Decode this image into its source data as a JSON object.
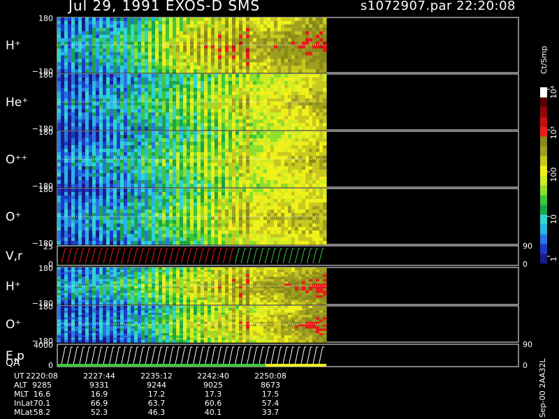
{
  "header": {
    "title_left": "Jul 29, 1991    EXOS-D SMS",
    "title_right": "s1072907.par  22:20:08"
  },
  "colorbar": {
    "unit_label": "Ct/Smp",
    "tick_labels": [
      "1",
      "10",
      "100",
      "10³",
      "10⁴"
    ],
    "colors": [
      "#1a1a8c",
      "#1c3cc8",
      "#2876e0",
      "#2ab4e6",
      "#30d6d0",
      "#1aa64a",
      "#3ec83a",
      "#8ee02c",
      "#d2ec24",
      "#f0f01a",
      "#c8c820",
      "#a0a020",
      "#8a8a1a",
      "#e81c1c",
      "#c01010",
      "#900808",
      "#5a0000",
      "#ffffff"
    ]
  },
  "footer_code": "Sep-00 2AA32L",
  "ephemeris": {
    "labels": [
      "UT",
      "ALT",
      "MLT",
      "InLat",
      "MLat"
    ],
    "columns": [
      [
        "2220:08",
        "9285",
        "16.6",
        "70.1",
        "58.2"
      ],
      [
        "2227:44",
        "9331",
        "16.9",
        "66.9",
        "52.3"
      ],
      [
        "2235:12",
        "9244",
        "17.2",
        "63.7",
        "46.3"
      ],
      [
        "2242:40",
        "9025",
        "17.3",
        "60.6",
        "40.1"
      ],
      [
        "2250:08",
        "8673",
        "17.5",
        "57.4",
        "33.7"
      ]
    ]
  },
  "chart_data": {
    "type": "heatmap",
    "time_axis": {
      "start": "2220:08",
      "end": "2250:08",
      "ticks": [
        "2220:08",
        "2227:44",
        "2235:12",
        "2242:40",
        "2250:08"
      ],
      "data_end": "2250:08"
    },
    "panels": [
      {
        "label": "H⁺",
        "kind": "angle-spectrogram",
        "ytick_top": "180",
        "ytick_bottom": "−180",
        "intensity_profile": [
          2,
          4,
          9,
          11,
          13
        ]
      },
      {
        "label": "He⁺",
        "kind": "angle-spectrogram",
        "ytick_top": "180",
        "ytick_bottom": "−180",
        "intensity_profile": [
          1,
          3,
          6,
          9,
          11
        ]
      },
      {
        "label": "O⁺⁺",
        "kind": "angle-spectrogram",
        "ytick_top": "180",
        "ytick_bottom": "−180",
        "intensity_profile": [
          1,
          3,
          6,
          9,
          11
        ]
      },
      {
        "label": "O⁺",
        "kind": "angle-spectrogram",
        "ytick_top": "180",
        "ytick_bottom": "−180",
        "intensity_profile": [
          1,
          3,
          6,
          10,
          11
        ]
      },
      {
        "label": "V,r",
        "kind": "line",
        "ytick_top": "25",
        "ytick_bottom": "0",
        "right_top": "90",
        "right_bottom": "0"
      },
      {
        "label": "H⁺",
        "kind": "angle-spectrogram",
        "ytick_top": "180",
        "ytick_bottom": "−180",
        "intensity_profile": [
          2,
          4,
          8,
          11,
          13
        ]
      },
      {
        "label": "O⁺",
        "kind": "angle-spectrogram",
        "ytick_top": "180",
        "ytick_bottom": "−180",
        "intensity_profile": [
          1,
          2,
          7,
          10,
          13
        ]
      },
      {
        "label": "E,p",
        "label2": "QA",
        "kind": "line",
        "ytick_top": "4000",
        "ytick_bottom": "0",
        "right_top": "90",
        "right_bottom": "0"
      }
    ]
  }
}
